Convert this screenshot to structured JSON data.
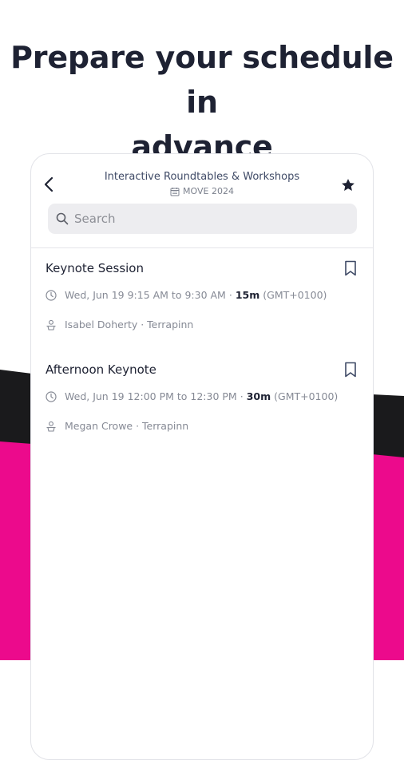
{
  "headline": {
    "line1": "Prepare your schedule in",
    "line2": "advance"
  },
  "colors": {
    "accent_pink": "#ec0a8c",
    "dark": "#1a1a1c",
    "text_primary": "#1e2233",
    "text_secondary": "#868a95",
    "title_text": "#3f4a66"
  },
  "header": {
    "title": "Interactive Roundtables & Workshops",
    "event_name": "MOVE 2024",
    "back_icon": "chevron-left-icon",
    "favorite_icon": "star-icon"
  },
  "search": {
    "placeholder": "Search",
    "value": ""
  },
  "sessions": [
    {
      "title": "Keynote Session",
      "time_range": "Wed, Jun 19 9:15 AM to 9:30 AM",
      "separator": "·",
      "duration": "15m",
      "timezone": "(GMT+0100)",
      "speaker": "Isabel Doherty · Terrapinn"
    },
    {
      "title": "Afternoon Keynote",
      "time_range": "Wed, Jun 19 12:00 PM to 12:30 PM",
      "separator": "·",
      "duration": "30m",
      "timezone": "(GMT+0100)",
      "speaker": "Megan Crowe · Terrapinn"
    }
  ]
}
